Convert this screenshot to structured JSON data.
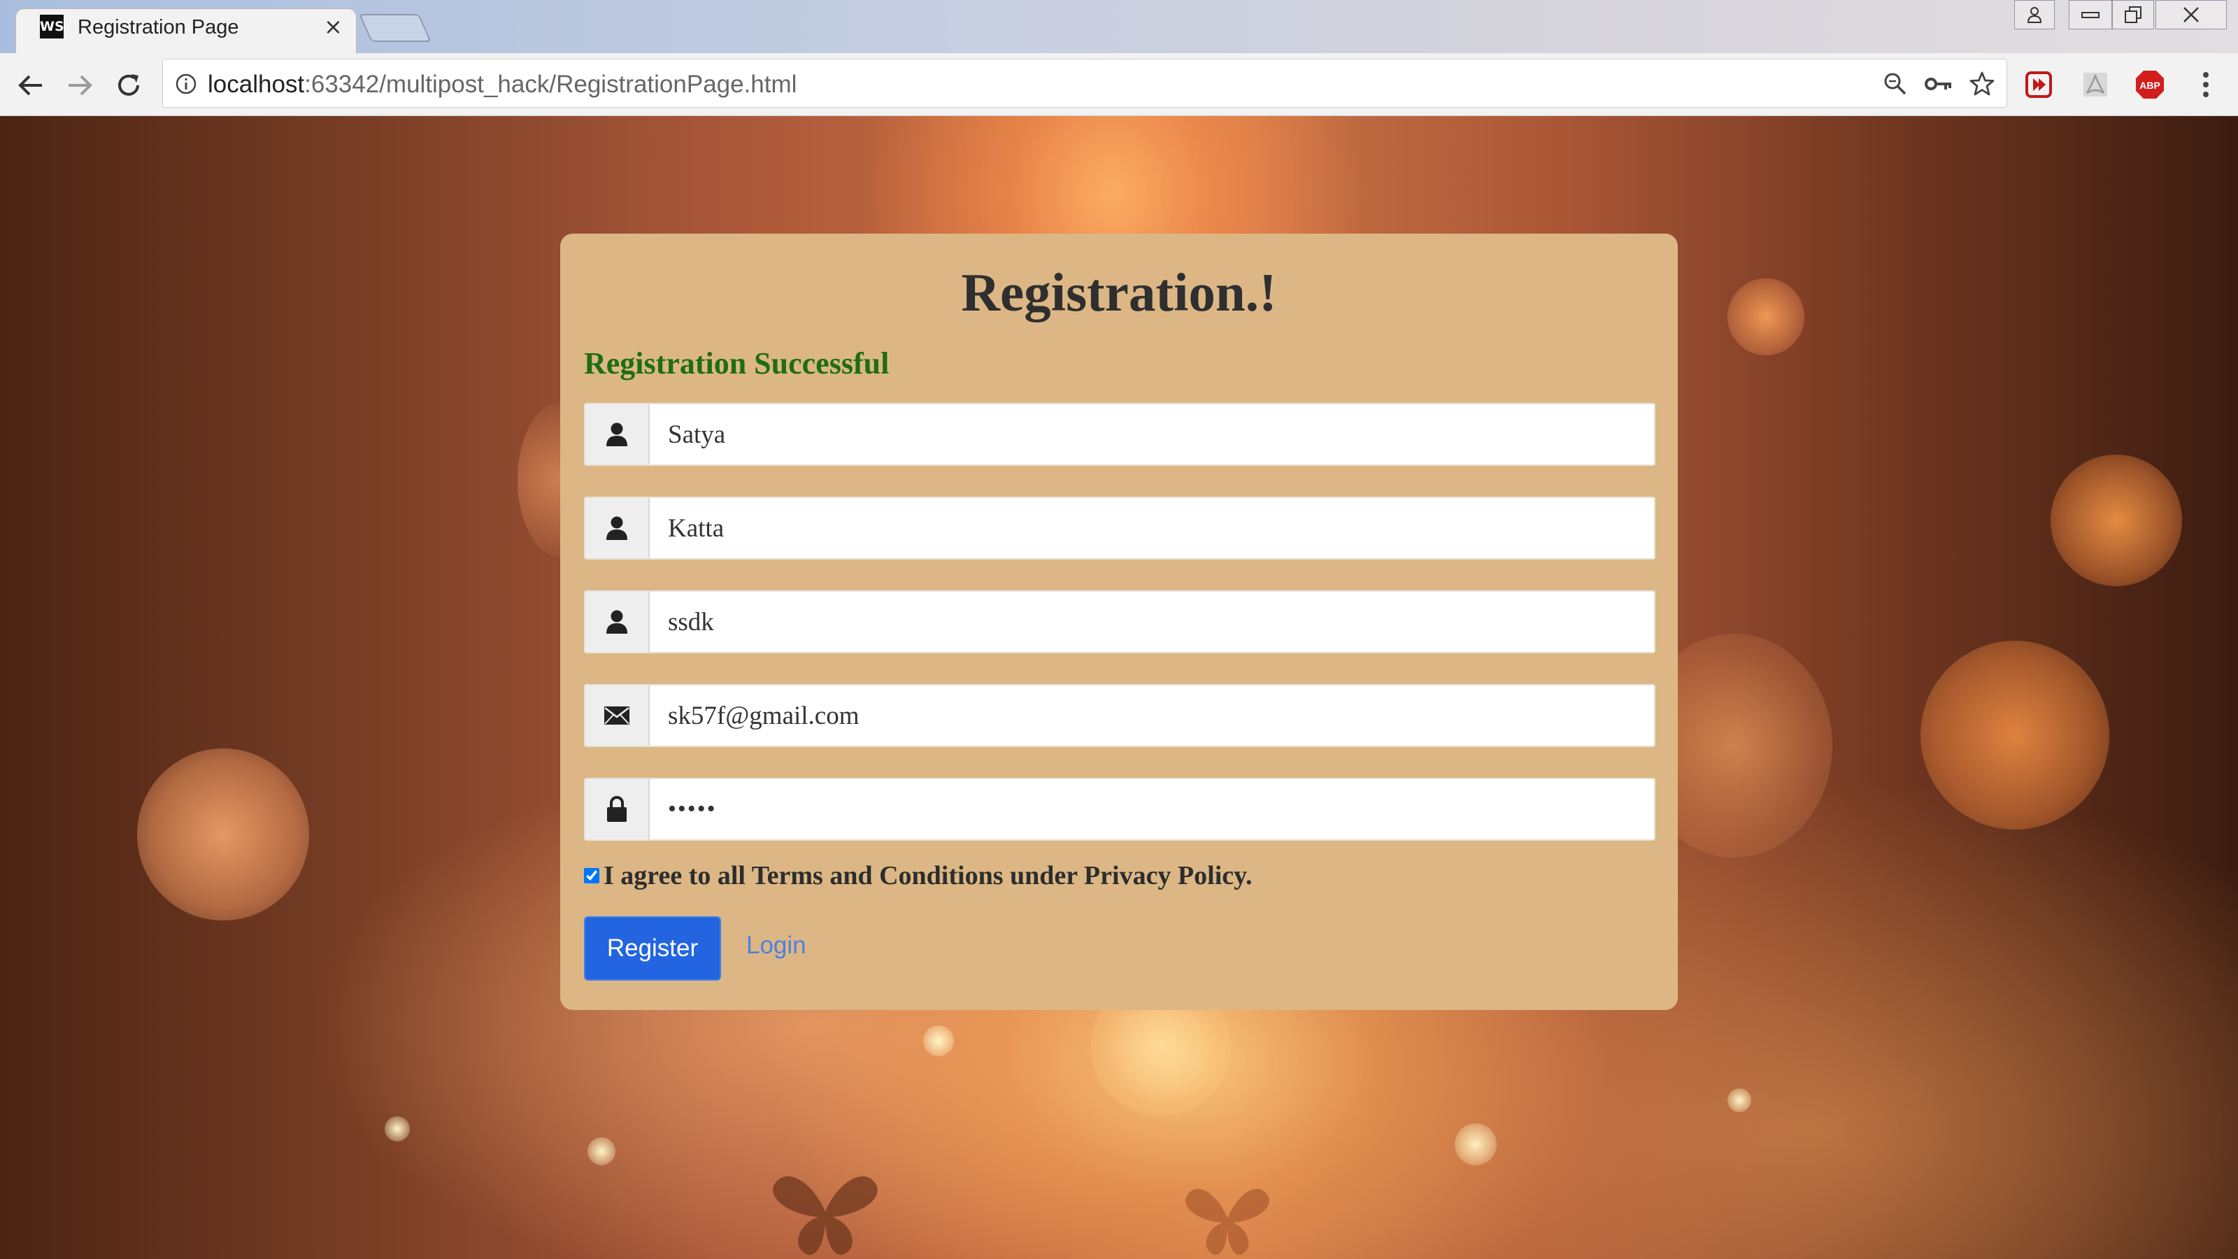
{
  "browser": {
    "tab": {
      "favicon_text": "WS",
      "title": "Registration Page",
      "close_glyph": "×"
    },
    "address_bar": {
      "host": "localhost",
      "rest": ":63342/multipost_hack/RegistrationPage.html"
    },
    "extensions": {
      "adblock_label": "ABP"
    },
    "icons": [
      "back-icon",
      "forward-icon",
      "reload-icon",
      "info-icon",
      "zoom-icon",
      "key-icon",
      "star-icon",
      "menu-icon"
    ]
  },
  "form": {
    "title": "Registration.!",
    "status_message": "Registration Successful",
    "status_color": "#1f6d12",
    "fields": [
      {
        "name": "first-name",
        "icon": "user-icon",
        "value": "Satya"
      },
      {
        "name": "last-name",
        "icon": "user-icon",
        "value": "Katta"
      },
      {
        "name": "username",
        "icon": "user-icon",
        "value": "ssdk"
      },
      {
        "name": "email",
        "icon": "envelope-icon",
        "value": "sk57f@gmail.com"
      },
      {
        "name": "password",
        "icon": "lock-icon",
        "value": "•••••"
      }
    ],
    "agree_text": "I agree to all Terms and Conditions under Privacy Policy.",
    "agree_checked": true,
    "register_label": "Register",
    "login_label": "Login",
    "accent_color": "#2365e0"
  }
}
